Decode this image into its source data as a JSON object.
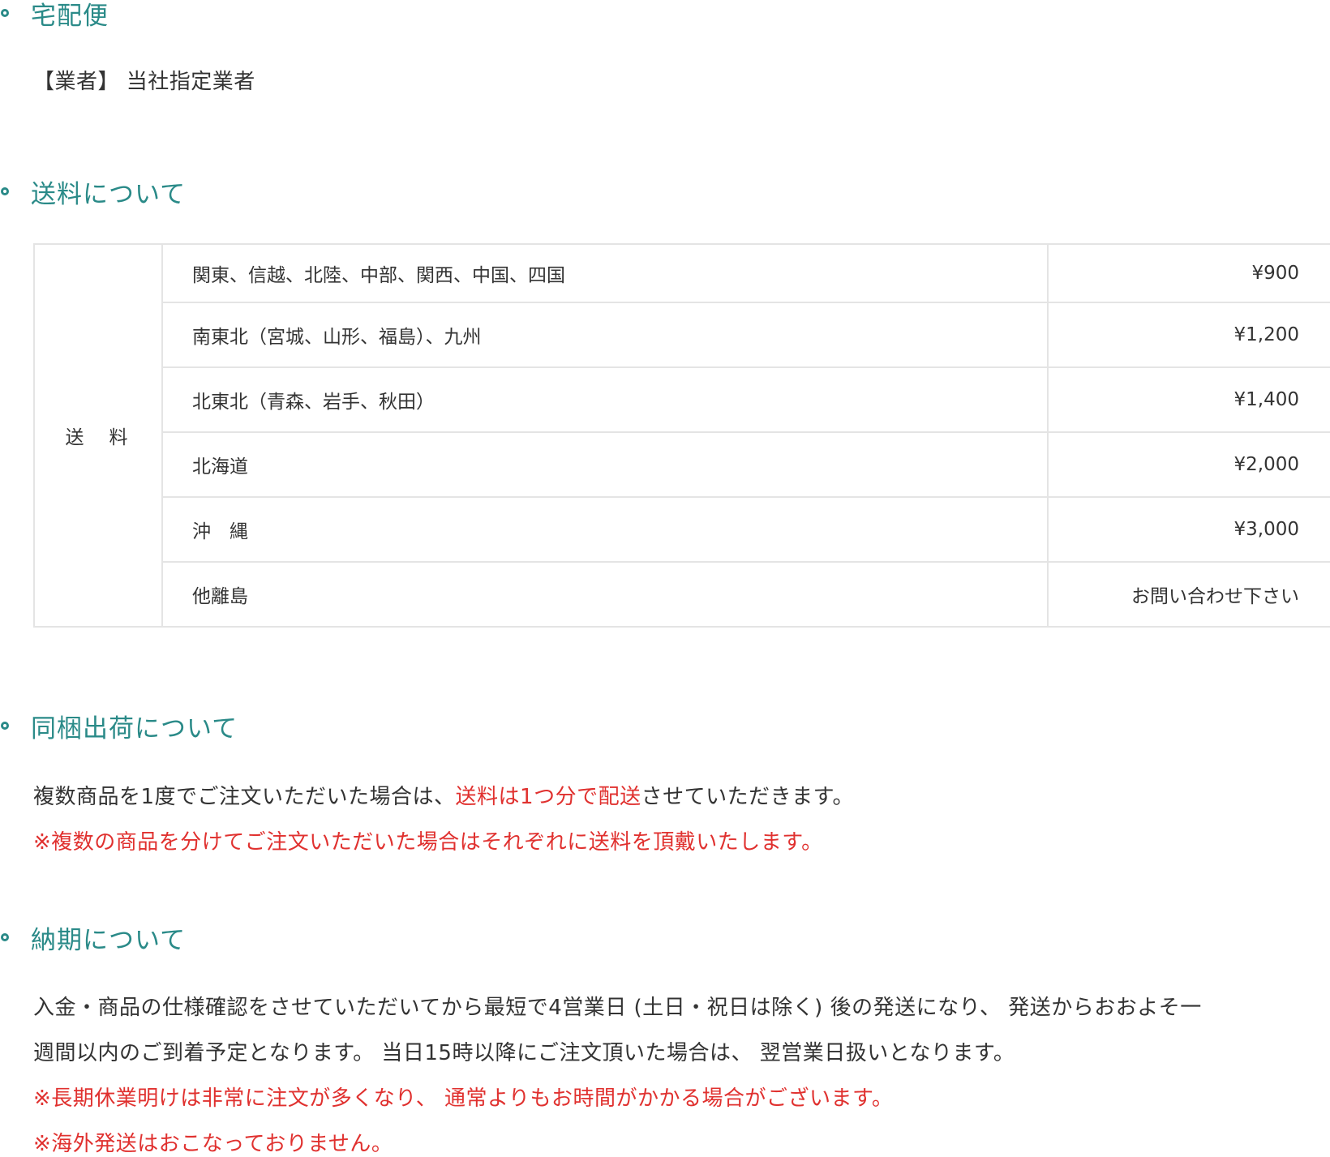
{
  "sections": {
    "delivery": {
      "title": "宅配便",
      "line": "【業者】 当社指定業者"
    },
    "shipping": {
      "title": "送料について",
      "header_label": "送　料",
      "rows": [
        {
          "region": "関東、信越、北陸、中部、関西、中国、四国",
          "price": "¥900"
        },
        {
          "region": "南東北（宮城、山形、福島）、九州",
          "price": "¥1,200"
        },
        {
          "region": "北東北（青森、岩手、秋田）",
          "price": "¥1,400"
        },
        {
          "region": "北海道",
          "price": "¥2,000"
        },
        {
          "region": "沖　縄",
          "price": "¥3,000"
        },
        {
          "region": "他離島",
          "price": "お問い合わせ下さい"
        }
      ]
    },
    "bundle": {
      "title": "同梱出荷について",
      "line1_a": "複数商品を1度でご注文いただいた場合は、",
      "line1_b": "送料は1つ分で配送",
      "line1_c": "させていただきます。",
      "line2": "※複数の商品を分けてご注文いただいた場合はそれぞれに送料を頂戴いたします。"
    },
    "delivery_time": {
      "title": "納期について",
      "line1": "入金・商品の仕様確認をさせていただいてから最短で4営業日 (土日・祝日は除く) 後の発送になり、 発送からおおよそ一",
      "line2": "週間以内のご到着予定となります。 当日15時以降にご注文頂いた場合は、 翌営業日扱いとなります。",
      "line3": "※長期休業明けは非常に注文が多くなり、 通常よりもお時間がかかる場合がございます。",
      "line4": "※海外発送はおこなっておりません。"
    }
  },
  "colors": {
    "accent": "#2a8a88",
    "text": "#333333",
    "warning": "#e0312f",
    "border": "#e4e4e4"
  },
  "icons": {
    "bullet": "circle-bullet-icon"
  }
}
